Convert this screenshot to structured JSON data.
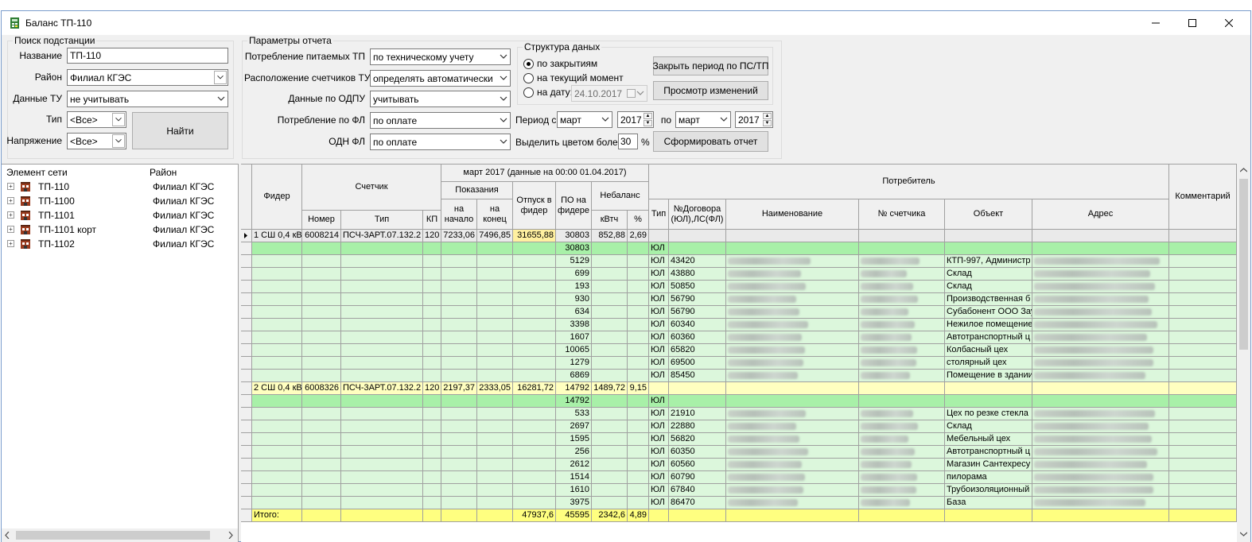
{
  "window": {
    "title": "Баланс ТП-110"
  },
  "search": {
    "legend": "Поиск подстанции",
    "name_label": "Название",
    "name_value": "ТП-110",
    "district_label": "Район",
    "district_value": "Филиал КГЭС",
    "tu_label": "Данные ТУ",
    "tu_value": "не учитывать",
    "type_label": "Тип",
    "type_value": "<Все>",
    "voltage_label": "Напряжение",
    "voltage_value": "<Все>",
    "find_button": "Найти"
  },
  "params": {
    "legend": "Параметры отчета",
    "consumption_tp_label": "Потребление питаемых ТП",
    "consumption_tp_value": "по техническому учету",
    "meters_label": "Расположение счетчиков ТУ",
    "meters_value": "определять автоматически",
    "odpu_label": "Данные по ОДПУ",
    "odpu_value": "учитывать",
    "fl_label": "Потребление по ФЛ",
    "fl_value": "по оплате",
    "odn_label": "ОДН ФЛ",
    "odn_value": "по оплате",
    "period_label": "Период с",
    "period_from_month": "март",
    "period_from_year": "2017",
    "period_to_label": "по",
    "period_to_month": "март",
    "period_to_year": "2017",
    "highlight_label": "Выделить цветом более",
    "highlight_value": "30",
    "highlight_unit": "%",
    "close_period_button": "Закрыть период по ПС/ТП",
    "view_changes_button": "Просмотр изменений",
    "build_report_button": "Сформировать отчет"
  },
  "structure": {
    "legend": "Структура даных",
    "opt_closures": "по закрытиям",
    "opt_current": "на текущий момент",
    "opt_date": "на дату:",
    "date_value": "24.10.2017"
  },
  "tree": {
    "col_element": "Элемент сети",
    "col_district": "Район",
    "items": [
      {
        "name": "ТП-110",
        "district": "Филиал КГЭС"
      },
      {
        "name": "ТП-1100",
        "district": "Филиал КГЭС"
      },
      {
        "name": "ТП-1101",
        "district": "Филиал КГЭС"
      },
      {
        "name": "ТП-1101 корт",
        "district": "Филиал КГЭС"
      },
      {
        "name": "ТП-1102",
        "district": "Филиал КГЭС"
      }
    ]
  },
  "grid": {
    "headers": {
      "feeder": "Фидер",
      "meter": "Счетчик",
      "number": "Номер",
      "type": "Тип",
      "kp": "КП",
      "period": "март 2017 (данные на 00:00 01.04.2017)",
      "readings": "Показания",
      "start": "на начало",
      "end": "на конец",
      "release": "Отпуск в фидер",
      "po": "ПО на фидере",
      "imbalance": "Небаланс",
      "kwh": "кВтч",
      "pct": "%",
      "consumer": "Потребитель",
      "ctype": "Тип",
      "contract": "№Договора (ЮЛ),ЛС(ФЛ)",
      "cname": "Наименование",
      "cmeter": "№ счетчика",
      "object": "Объект",
      "address": "Адрес",
      "comment": "Комментарий"
    },
    "rows": [
      {
        "kind": "feeder",
        "feeder": "1 СШ 0,4 кВ",
        "number": "6008214",
        "type": "ПСЧ-3АРТ.07.132.2",
        "kp": "120",
        "start": "7233,06",
        "end": "7496,85",
        "release": "31655,88",
        "po": "30803",
        "kwh": "852,88",
        "pct": "2,69",
        "ctype": "",
        "contract": "",
        "object": ""
      },
      {
        "kind": "sub",
        "po": "30803",
        "ctype": "ЮЛ",
        "contract": "",
        "object": ""
      },
      {
        "kind": "item",
        "po": "5129",
        "ctype": "ЮЛ",
        "contract": "43420",
        "object": "КТП-997, Администр"
      },
      {
        "kind": "item",
        "po": "699",
        "ctype": "ЮЛ",
        "contract": "43880",
        "object": "Склад"
      },
      {
        "kind": "item",
        "po": "193",
        "ctype": "ЮЛ",
        "contract": "50850",
        "object": "Склад"
      },
      {
        "kind": "item",
        "po": "930",
        "ctype": "ЮЛ",
        "contract": "56790",
        "object": "Производственная б"
      },
      {
        "kind": "item",
        "po": "634",
        "ctype": "ЮЛ",
        "contract": "56790",
        "object": "Субабонент ООО Зау"
      },
      {
        "kind": "item",
        "po": "3398",
        "ctype": "ЮЛ",
        "contract": "60340",
        "object": "Нежилое помещение"
      },
      {
        "kind": "item",
        "po": "1607",
        "ctype": "ЮЛ",
        "contract": "60360",
        "object": "Автотранспортный ц"
      },
      {
        "kind": "item",
        "po": "10065",
        "ctype": "ЮЛ",
        "contract": "65820",
        "object": "Колбасный цех"
      },
      {
        "kind": "item",
        "po": "1279",
        "ctype": "ЮЛ",
        "contract": "69500",
        "object": "столярный цех"
      },
      {
        "kind": "item",
        "po": "6869",
        "ctype": "ЮЛ",
        "contract": "85450",
        "object": "Помещение в здании"
      },
      {
        "kind": "feeder2",
        "feeder": "2 СШ 0,4 кВ",
        "number": "6008326",
        "type": "ПСЧ-3АРТ.07.132.2",
        "kp": "120",
        "start": "2197,37",
        "end": "2333,05",
        "release": "16281,72",
        "po": "14792",
        "kwh": "1489,72",
        "pct": "9,15",
        "ctype": "",
        "contract": "",
        "object": ""
      },
      {
        "kind": "sub",
        "po": "14792",
        "ctype": "ЮЛ",
        "contract": "",
        "object": ""
      },
      {
        "kind": "item",
        "po": "533",
        "ctype": "ЮЛ",
        "contract": "21910",
        "object": "Цех по резке стекла"
      },
      {
        "kind": "item",
        "po": "2697",
        "ctype": "ЮЛ",
        "contract": "22880",
        "object": "Склад"
      },
      {
        "kind": "item",
        "po": "1595",
        "ctype": "ЮЛ",
        "contract": "56820",
        "object": "Мебельный цех"
      },
      {
        "kind": "item",
        "po": "256",
        "ctype": "ЮЛ",
        "contract": "60350",
        "object": "Автотранспортный ц"
      },
      {
        "kind": "item",
        "po": "2612",
        "ctype": "ЮЛ",
        "contract": "60560",
        "object": "Магазин Сантехресу"
      },
      {
        "kind": "item",
        "po": "1514",
        "ctype": "ЮЛ",
        "contract": "60790",
        "object": "пилорама"
      },
      {
        "kind": "item",
        "po": "1610",
        "ctype": "ЮЛ",
        "contract": "67840",
        "object": "Трубоизоляционный"
      },
      {
        "kind": "item",
        "po": "3975",
        "ctype": "ЮЛ",
        "contract": "86470",
        "object": "База"
      },
      {
        "kind": "total",
        "feeder": "Итого:",
        "release": "47937,6",
        "po": "45595",
        "kwh": "2342,6",
        "pct": "4,89",
        "ctype": "",
        "contract": "",
        "object": ""
      }
    ]
  },
  "colors": {
    "feeder_row": "#eaeaea",
    "sub_row": "#a8f0a8",
    "item_row": "#dcf7dc",
    "feeder2_row": "#ffffc0",
    "total_row": "#ffff80",
    "release_highlight": "#fff0a0"
  }
}
